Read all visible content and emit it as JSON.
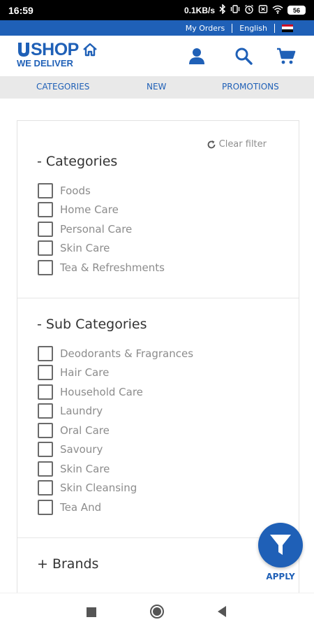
{
  "statusbar": {
    "time": "16:59",
    "speed": "0.1KB/s",
    "battery": "56"
  },
  "topstrip": {
    "my_orders": "My Orders",
    "language": "English"
  },
  "header": {
    "logo_line1": "SHOP",
    "logo_line2": "WE DELIVER",
    "brand_color": "#1f60b7"
  },
  "nav": {
    "tabs": [
      "CATEGORIES",
      "NEW",
      "PROMOTIONS"
    ]
  },
  "filter": {
    "clear_label": "Clear filter",
    "categories": {
      "title": "- Categories",
      "options": [
        "Foods",
        "Home Care",
        "Personal Care",
        "Skin Care",
        "Tea & Refreshments"
      ]
    },
    "subcategories": {
      "title": "- Sub Categories",
      "options": [
        "Deodorants & Fragrances",
        "Hair Care",
        "Household Care",
        "Laundry",
        "Oral Care",
        "Savoury",
        "Skin Care",
        "Skin Cleansing",
        "Tea And"
      ]
    },
    "brands": {
      "title": "+ Brands"
    }
  },
  "fab": {
    "label": "APPLY"
  }
}
